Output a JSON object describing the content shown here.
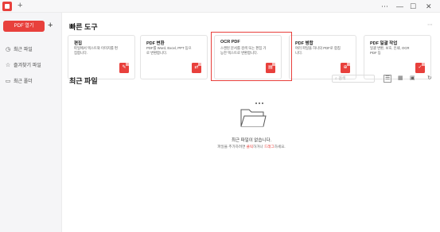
{
  "titlebar": {
    "new_tab": "+",
    "more": "⋯",
    "minimize": "—",
    "maximize": "☐",
    "close": "✕"
  },
  "sidebar": {
    "open_pdf": "PDF 열기",
    "add": "+",
    "items": [
      {
        "icon": "clock-icon",
        "label": "최근 파일"
      },
      {
        "icon": "star-icon",
        "label": "즐겨찾기 파일"
      },
      {
        "icon": "folder-icon",
        "label": "최근 폴더"
      }
    ]
  },
  "quick_tools": {
    "title": "빠른 도구",
    "more": "⋯",
    "cards": [
      {
        "title": "편집",
        "desc": "파일에서 텍스트와 이미지를 편집합니다.",
        "icon": "edit-icon"
      },
      {
        "title": "PDF 변환",
        "desc": "PDF를 Word, Excel, PPT 등으로 변환합니다.",
        "icon": "convert-icon"
      },
      {
        "title": "OCR PDF",
        "desc": "스캔된 문서를 검색 또는 편집 가능한 텍스트로 변환합니다.",
        "icon": "ocr-icon"
      },
      {
        "title": "PDF 병합",
        "desc": "여러 파일을 하나의 PDF로 합칩니다.",
        "icon": "merge-icon"
      },
      {
        "title": "PDF 일괄 작업",
        "desc": "일괄 변환, 보호, 인쇄, OCR PDF 등",
        "icon": "batch-icon"
      }
    ],
    "highlight_color": "#e8403c"
  },
  "recent_files": {
    "title": "최근 파일",
    "search_placeholder": "검색",
    "empty_title": "최근 파일이 없습니다.",
    "empty_desc_before": "파일을 추가하려면 ",
    "empty_link_click": "클릭",
    "empty_desc_mid": "하거나 ",
    "empty_link_drag": "드래그",
    "empty_desc_after": "하세요."
  },
  "colors": {
    "accent": "#e8403c"
  }
}
